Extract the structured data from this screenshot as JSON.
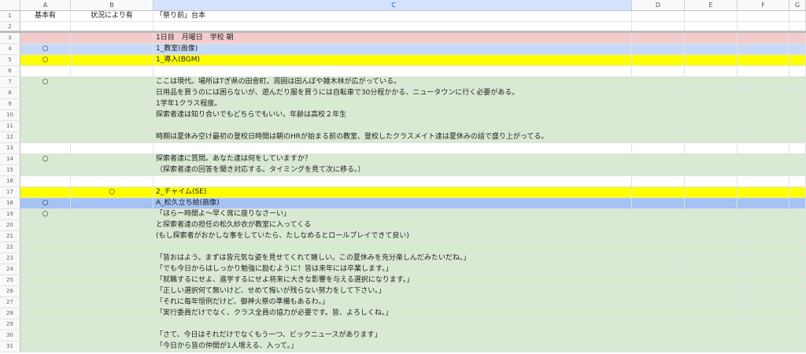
{
  "columns": [
    "A",
    "B",
    "C",
    "D",
    "E",
    "F",
    "G"
  ],
  "rows": [
    {
      "n": "1",
      "a": "基本有",
      "b": "状況により有",
      "c": "「祭り前」台本",
      "style": "white"
    },
    {
      "n": "2",
      "a": "",
      "b": "",
      "c": "",
      "style": "white"
    },
    {
      "n": "3",
      "a": "",
      "b": "",
      "c": "1日目　月曜日　学校 朝",
      "style": "pink"
    },
    {
      "n": "4",
      "a": "○",
      "b": "",
      "c": "1_教室(画像)",
      "style": "lblue"
    },
    {
      "n": "5",
      "a": "○",
      "b": "",
      "c": "1_導入(BGM)",
      "style": "yellow"
    },
    {
      "n": "6",
      "a": "",
      "b": "",
      "c": "",
      "style": "white"
    },
    {
      "n": "7",
      "a": "○",
      "b": "",
      "c": "ここは現代。場所はTぎ県の田舎町。周囲は田んぼや雑木林が広がっている。",
      "style": "green"
    },
    {
      "n": "8",
      "a": "",
      "b": "",
      "c": "日用品を買うのには困らないが、遊んだり服を買うには自転車で30分程かかる、ニュータウンに行く必要がある。",
      "style": "green"
    },
    {
      "n": "9",
      "a": "",
      "b": "",
      "c": "1学年1クラス程度。",
      "style": "green"
    },
    {
      "n": "10",
      "a": "",
      "b": "",
      "c": "探索者達は知り合いでもどちらでもいい。年齢は高校２年生",
      "style": "green"
    },
    {
      "n": "11",
      "a": "",
      "b": "",
      "c": "",
      "style": "green"
    },
    {
      "n": "12",
      "a": "",
      "b": "",
      "c": "時期は夏休み空け最初の登校日時間は朝のHRが始まる前の教室、登校したクラスメイト達は夏休みの話で盛り上がってる。",
      "style": "green"
    },
    {
      "n": "13",
      "a": "",
      "b": "",
      "c": "",
      "style": "white"
    },
    {
      "n": "14",
      "a": "○",
      "b": "",
      "c": "探索者達に質問。あなた達は何をしていますか？",
      "style": "green"
    },
    {
      "n": "15",
      "a": "",
      "b": "",
      "c": "（探索者達の回答を聞き対応する。タイミングを見て次に移る。）",
      "style": "green"
    },
    {
      "n": "16",
      "a": "",
      "b": "",
      "c": "",
      "style": "white"
    },
    {
      "n": "17",
      "a": "",
      "b": "○",
      "c": "2_チャイム(SE)",
      "style": "yellow"
    },
    {
      "n": "18",
      "a": "○",
      "b": "",
      "c": "A_松久立ち絵(画像)",
      "style": "blue"
    },
    {
      "n": "19",
      "a": "○",
      "b": "",
      "c": "「ほらー時間よ～早く席に座りなさーい」",
      "style": "green"
    },
    {
      "n": "20",
      "a": "",
      "b": "",
      "c": "と探索者達の担任の松久紗衣が教室に入ってくる",
      "style": "green"
    },
    {
      "n": "21",
      "a": "",
      "b": "",
      "c": "(もし探索者がおかしな事をしていたら、たしなめるとロールプレイできて良い)",
      "style": "green"
    },
    {
      "n": "22",
      "a": "",
      "b": "",
      "c": "",
      "style": "green"
    },
    {
      "n": "23",
      "a": "",
      "b": "",
      "c": "「皆おはよう。まずは皆元気な姿を見せてくれて嬉しい。この夏休みを充分楽しんだみたいだね。」",
      "style": "green"
    },
    {
      "n": "24",
      "a": "",
      "b": "",
      "c": "「でも今日からはしっかり勉強に励むように！皆は来年には卒業します。」",
      "style": "green"
    },
    {
      "n": "25",
      "a": "",
      "b": "",
      "c": "「就職するにせよ、進学するにせよ将来に大きな影響を与える選択になります。」",
      "style": "green"
    },
    {
      "n": "26",
      "a": "",
      "b": "",
      "c": "「正しい選択何て無いけど、せめて悔いが残らない努力をして下さい。」",
      "style": "green"
    },
    {
      "n": "27",
      "a": "",
      "b": "",
      "c": "「それに毎年恒例だけど、御神火祭の準備もあるわ。」",
      "style": "green"
    },
    {
      "n": "28",
      "a": "",
      "b": "",
      "c": "「実行委員だけでなく、クラス全員の協力が必要です。皆、よろしくね。」",
      "style": "green"
    },
    {
      "n": "29",
      "a": "",
      "b": "",
      "c": "",
      "style": "green"
    },
    {
      "n": "30",
      "a": "",
      "b": "",
      "c": "「さて、今日はそれだけでなくもう一つ、ビックニュースがあります」",
      "style": "green"
    },
    {
      "n": "31",
      "a": "",
      "b": "",
      "c": "「今日から皆の仲間が1人増える、入って。」",
      "style": "green"
    }
  ]
}
